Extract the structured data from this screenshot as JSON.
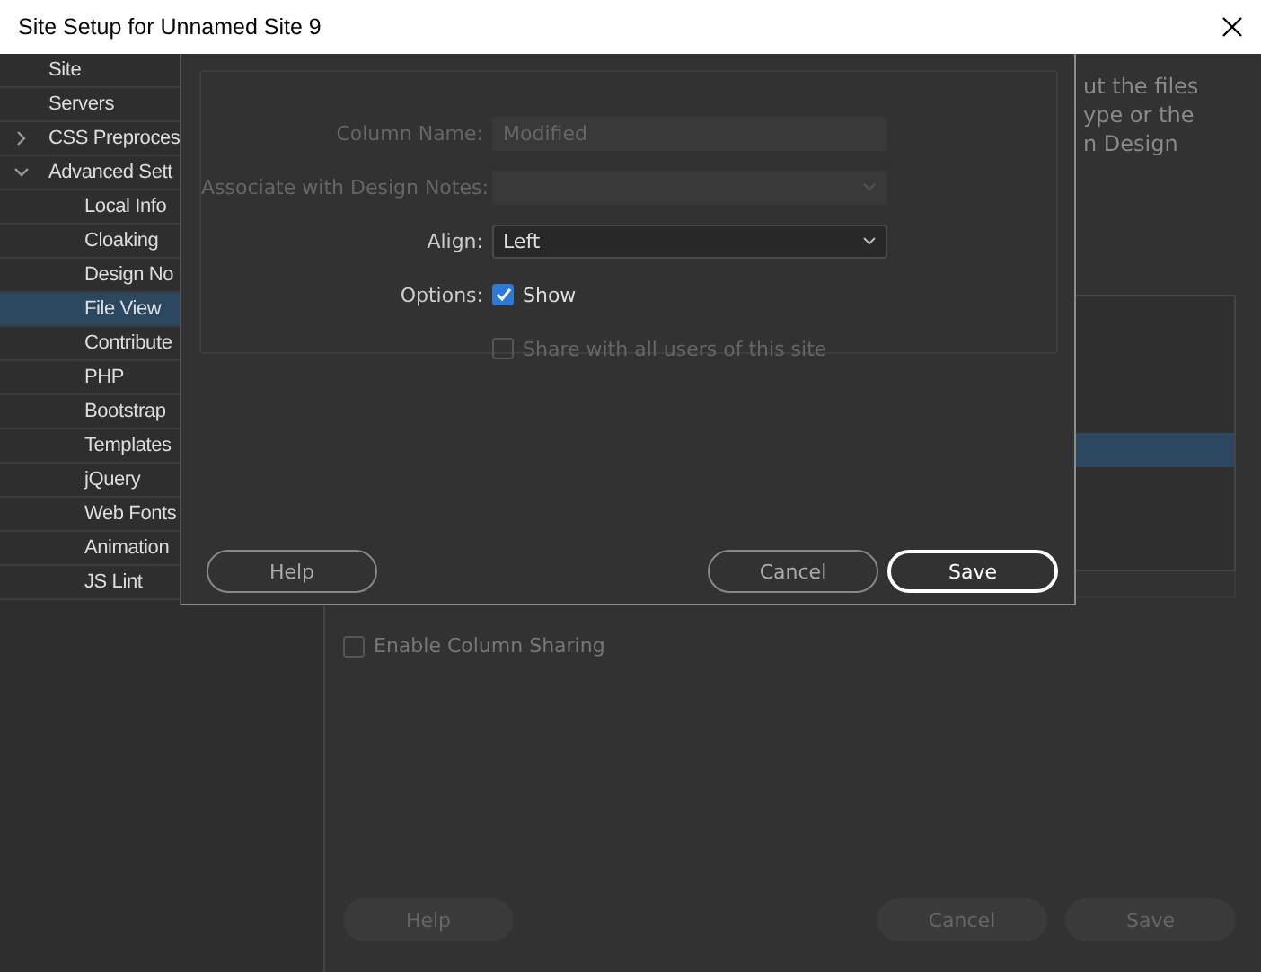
{
  "window": {
    "title": "Site Setup for Unnamed Site 9"
  },
  "sidebar": {
    "items": [
      {
        "label": "Site",
        "selected": false
      },
      {
        "label": "Servers",
        "selected": false
      },
      {
        "label": "CSS Preproces",
        "selected": false,
        "expanded": false
      },
      {
        "label": "Advanced Sett",
        "selected": false,
        "expanded": true,
        "children": [
          {
            "label": "Local Info",
            "selected": false
          },
          {
            "label": "Cloaking",
            "selected": false
          },
          {
            "label": "Design No",
            "selected": false
          },
          {
            "label": "File View",
            "selected": true
          },
          {
            "label": "Contribute",
            "selected": false
          },
          {
            "label": "PHP",
            "selected": false
          },
          {
            "label": "Bootstrap",
            "selected": false
          },
          {
            "label": "Templates",
            "selected": false
          },
          {
            "label": "jQuery",
            "selected": false
          },
          {
            "label": "Web Fonts",
            "selected": false
          },
          {
            "label": "Animation",
            "selected": false
          },
          {
            "label": "JS Lint",
            "selected": false
          }
        ]
      }
    ]
  },
  "main": {
    "description_lines": [
      "ut the files",
      "ype or the",
      "n Design"
    ],
    "columns_list": {
      "rows": [
        {
          "selected": false
        },
        {
          "selected": false
        },
        {
          "selected": false
        },
        {
          "selected": false
        },
        {
          "selected": true
        },
        {
          "selected": false
        },
        {
          "selected": false
        },
        {
          "selected": false
        }
      ]
    },
    "enable_column_sharing": {
      "label": "Enable Column Sharing",
      "checked": false,
      "disabled": true
    },
    "buttons": [
      {
        "label": "Help",
        "disabled": true
      },
      {
        "label": "Cancel",
        "disabled": true
      },
      {
        "label": "Save",
        "disabled": true
      }
    ]
  },
  "dialog": {
    "fields": [
      {
        "kind": "text",
        "label": "Column Name:",
        "value": "Modified",
        "disabled": true
      },
      {
        "kind": "select",
        "label": "Associate with Design Notes:",
        "disabled": true
      },
      {
        "kind": "select",
        "label": "Align:",
        "value": "Left",
        "disabled": false
      },
      {
        "kind": "checkbox",
        "label": "Options:",
        "text": "Show",
        "checked": true,
        "disabled": false
      },
      {
        "kind": "checkbox",
        "text": "Share with all users of this site",
        "checked": false,
        "disabled": true
      }
    ],
    "buttons": [
      {
        "label": "Help",
        "default": false
      },
      {
        "label": "Cancel",
        "default": false
      },
      {
        "label": "Save",
        "default": true
      }
    ]
  }
}
